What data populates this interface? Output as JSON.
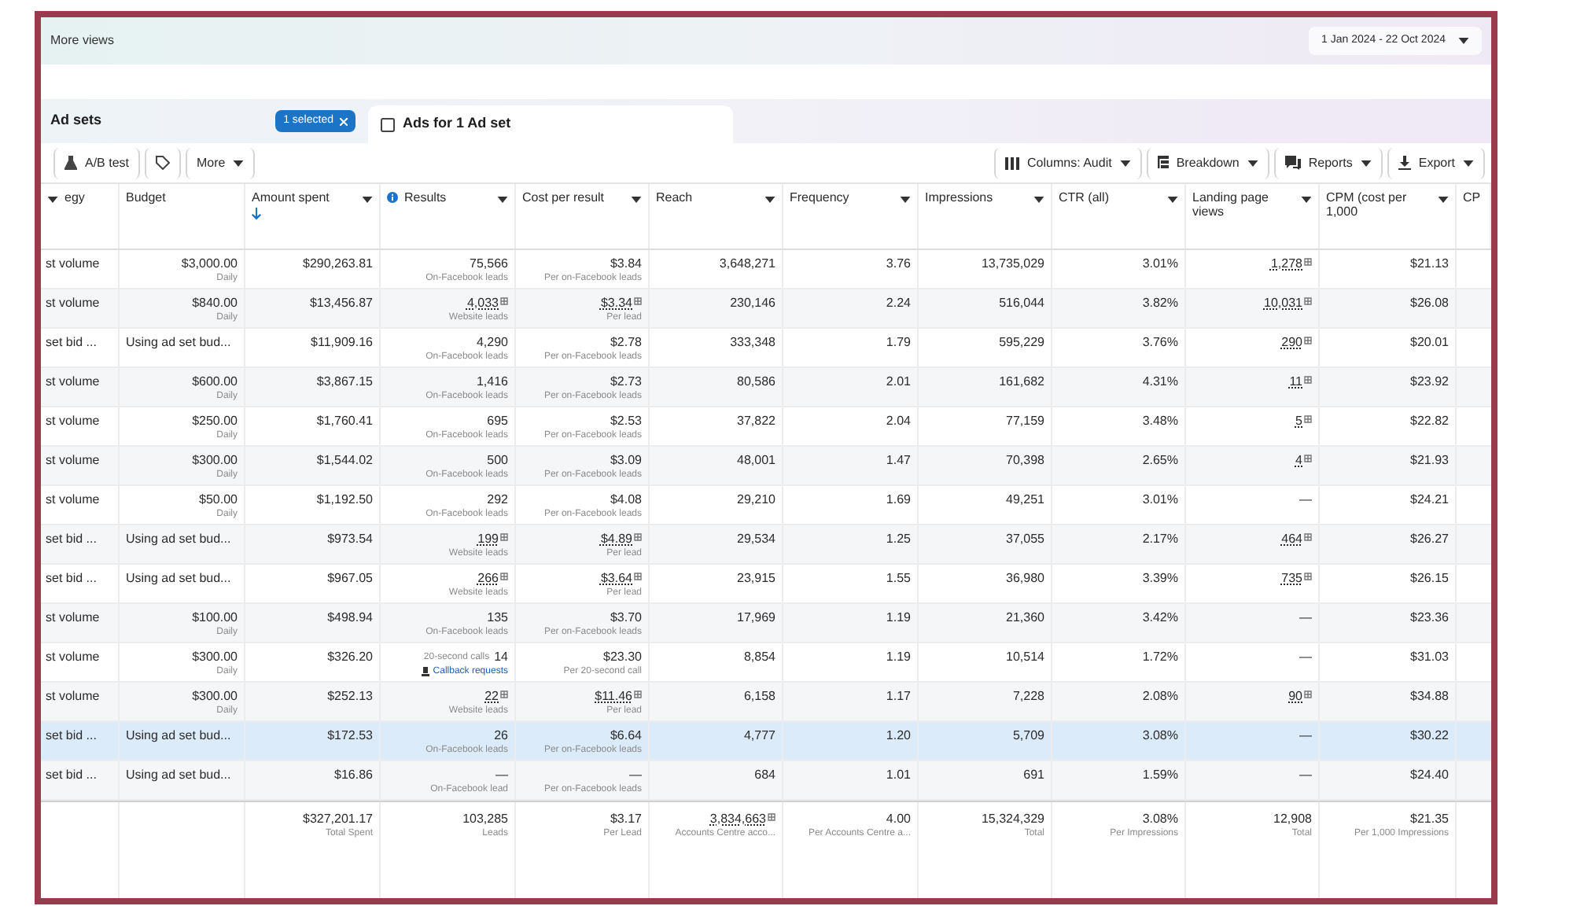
{
  "top_bar": {
    "title": "More views",
    "date_range": "1 Jan 2024 - 22 Oct 2024"
  },
  "tabs": [
    {
      "label": "Ad sets",
      "selected": false,
      "badge": "1 selected"
    },
    {
      "label": "Ads for 1 Ad set",
      "selected": true
    }
  ],
  "toolbar": {
    "left": [
      {
        "kind": "flask",
        "label": "A/B test",
        "caret": false
      },
      {
        "kind": "tag",
        "caret": false
      },
      {
        "kind": "none",
        "label": "More",
        "caret": true
      }
    ],
    "right": [
      {
        "kind": "columns",
        "label": "Columns: Audit",
        "caret": true
      },
      {
        "kind": "breakdown",
        "label": "Breakdown",
        "caret": true
      },
      {
        "kind": "reports",
        "label": "Reports",
        "caret": true
      },
      {
        "kind": "export",
        "label": "Export",
        "caret": true
      }
    ]
  },
  "table": {
    "leading_caret": true,
    "columns": [
      {
        "label": "egy",
        "caret": false,
        "sorted": false,
        "info": false
      },
      {
        "label": "Budget",
        "caret": false,
        "sorted": false,
        "info": false
      },
      {
        "label": "Amount spent",
        "caret": true,
        "sorted": true,
        "info": false
      },
      {
        "label": "Results",
        "caret": true,
        "sorted": false,
        "info": true
      },
      {
        "label": "Cost per result",
        "caret": true,
        "sorted": false,
        "info": false
      },
      {
        "label": "Reach",
        "caret": true,
        "sorted": false,
        "info": false
      },
      {
        "label": "Frequency",
        "caret": true,
        "sorted": false,
        "info": false
      },
      {
        "label": "Impressions",
        "caret": true,
        "sorted": false,
        "info": false
      },
      {
        "label": "CTR (all)",
        "caret": true,
        "sorted": false,
        "info": false
      },
      {
        "label": "Landing page views",
        "caret": true,
        "sorted": false,
        "info": false
      },
      {
        "label": "CPM (cost per 1,000",
        "caret": true,
        "sorted": false,
        "info": false
      },
      {
        "label": "CP",
        "caret": false,
        "sorted": false,
        "info": false
      }
    ],
    "rows": [
      {
        "selected": false,
        "strategy": "st volume",
        "budget": "$3,000.00",
        "budget_period": "Daily",
        "amount_spent": "$290,263.81",
        "results": "75,566",
        "results_label": "On-Facebook leads",
        "results_linked": false,
        "cost": "$3.84",
        "cost_label": "Per on-Facebook leads",
        "cost_linked": false,
        "reach": "3,648,271",
        "frequency": "3.76",
        "impressions": "13,735,029",
        "ctr": "3.01%",
        "landing_views": "1,278",
        "landing_linked": true,
        "cpm": "$21.13"
      },
      {
        "selected": false,
        "strategy": "st volume",
        "budget": "$840.00",
        "budget_period": "Daily",
        "amount_spent": "$13,456.87",
        "results": "4,033",
        "results_label": "Website leads",
        "results_linked": true,
        "cost": "$3.34",
        "cost_label": "Per lead",
        "cost_linked": true,
        "reach": "230,146",
        "frequency": "2.24",
        "impressions": "516,044",
        "ctr": "3.82%",
        "landing_views": "10,031",
        "landing_linked": true,
        "cpm": "$26.08"
      },
      {
        "selected": false,
        "strategy": "set bid ...",
        "budget": "Using ad set bud...",
        "amount_spent": "$11,909.16",
        "results": "4,290",
        "results_label": "On-Facebook leads",
        "results_linked": false,
        "cost": "$2.78",
        "cost_label": "Per on-Facebook leads",
        "cost_linked": false,
        "reach": "333,348",
        "frequency": "1.79",
        "impressions": "595,229",
        "ctr": "3.76%",
        "landing_views": "290",
        "landing_linked": true,
        "cpm": "$20.01"
      },
      {
        "selected": false,
        "strategy": "st volume",
        "budget": "$600.00",
        "budget_period": "Daily",
        "amount_spent": "$3,867.15",
        "results": "1,416",
        "results_label": "On-Facebook leads",
        "results_linked": false,
        "cost": "$2.73",
        "cost_label": "Per on-Facebook leads",
        "cost_linked": false,
        "reach": "80,586",
        "frequency": "2.01",
        "impressions": "161,682",
        "ctr": "4.31%",
        "landing_views": "11",
        "landing_linked": true,
        "cpm": "$23.92"
      },
      {
        "selected": false,
        "strategy": "st volume",
        "budget": "$250.00",
        "budget_period": "Daily",
        "amount_spent": "$1,760.41",
        "results": "695",
        "results_label": "On-Facebook leads",
        "results_linked": false,
        "cost": "$2.53",
        "cost_label": "Per on-Facebook leads",
        "cost_linked": false,
        "reach": "37,822",
        "frequency": "2.04",
        "impressions": "77,159",
        "ctr": "3.48%",
        "landing_views": "5",
        "landing_linked": true,
        "cpm": "$22.82"
      },
      {
        "selected": false,
        "strategy": "st volume",
        "budget": "$300.00",
        "budget_period": "Daily",
        "amount_spent": "$1,544.02",
        "results": "500",
        "results_label": "On-Facebook leads",
        "results_linked": false,
        "cost": "$3.09",
        "cost_label": "Per on-Facebook leads",
        "cost_linked": false,
        "reach": "48,001",
        "frequency": "1.47",
        "impressions": "70,398",
        "ctr": "2.65%",
        "landing_views": "4",
        "landing_linked": true,
        "cpm": "$21.93"
      },
      {
        "selected": false,
        "strategy": "st volume",
        "budget": "$50.00",
        "budget_period": "Daily",
        "amount_spent": "$1,192.50",
        "results": "292",
        "results_label": "On-Facebook leads",
        "results_linked": false,
        "cost": "$4.08",
        "cost_label": "Per on-Facebook leads",
        "cost_linked": false,
        "reach": "29,210",
        "frequency": "1.69",
        "impressions": "49,251",
        "ctr": "3.01%",
        "landing_views": "—",
        "landing_linked": false,
        "cpm": "$24.21"
      },
      {
        "selected": false,
        "strategy": "set bid ...",
        "budget": "Using ad set bud...",
        "amount_spent": "$973.54",
        "results": "199",
        "results_label": "Website leads",
        "results_linked": true,
        "cost": "$4.89",
        "cost_label": "Per lead",
        "cost_linked": true,
        "reach": "29,534",
        "frequency": "1.25",
        "impressions": "37,055",
        "ctr": "2.17%",
        "landing_views": "464",
        "landing_linked": true,
        "cpm": "$26.27"
      },
      {
        "selected": false,
        "strategy": "set bid ...",
        "budget": "Using ad set bud...",
        "amount_spent": "$967.05",
        "results": "266",
        "results_label": "Website leads",
        "results_linked": true,
        "cost": "$3.64",
        "cost_label": "Per lead",
        "cost_linked": true,
        "reach": "23,915",
        "frequency": "1.55",
        "impressions": "36,980",
        "ctr": "3.39%",
        "landing_views": "735",
        "landing_linked": true,
        "cpm": "$26.15"
      },
      {
        "selected": false,
        "strategy": "st volume",
        "budget": "$100.00",
        "budget_period": "Daily",
        "amount_spent": "$498.94",
        "results": "135",
        "results_label": "On-Facebook leads",
        "results_linked": false,
        "cost": "$3.70",
        "cost_label": "Per on-Facebook leads",
        "cost_linked": false,
        "reach": "17,969",
        "frequency": "1.19",
        "impressions": "21,360",
        "ctr": "3.42%",
        "landing_views": "—",
        "landing_linked": false,
        "cpm": "$23.36"
      },
      {
        "selected": false,
        "strategy": "st volume",
        "budget": "$300.00",
        "budget_period": "Daily",
        "amount_spent": "$326.20",
        "results_note": "20-second calls",
        "results": "14",
        "results_action": "Callback requests",
        "results_linked": false,
        "cost": "$23.30",
        "cost_label": "Per 20-second call",
        "cost_linked": false,
        "reach": "8,854",
        "frequency": "1.19",
        "impressions": "10,514",
        "ctr": "1.72%",
        "landing_views": "—",
        "landing_linked": false,
        "cpm": "$31.03"
      },
      {
        "selected": false,
        "strategy": "st volume",
        "budget": "$300.00",
        "budget_period": "Daily",
        "amount_spent": "$252.13",
        "results": "22",
        "results_label": "Website leads",
        "results_linked": true,
        "cost": "$11.46",
        "cost_label": "Per lead",
        "cost_linked": true,
        "reach": "6,158",
        "frequency": "1.17",
        "impressions": "7,228",
        "ctr": "2.08%",
        "landing_views": "90",
        "landing_linked": true,
        "cpm": "$34.88"
      },
      {
        "selected": true,
        "strategy": "set bid ...",
        "budget": "Using ad set bud...",
        "amount_spent": "$172.53",
        "results": "26",
        "results_label": "On-Facebook leads",
        "results_linked": false,
        "cost": "$6.64",
        "cost_label": "Per on-Facebook leads",
        "cost_linked": false,
        "reach": "4,777",
        "frequency": "1.20",
        "impressions": "5,709",
        "ctr": "3.08%",
        "landing_views": "—",
        "landing_linked": false,
        "cpm": "$30.22"
      },
      {
        "selected": false,
        "strategy": "set bid ...",
        "budget": "Using ad set bud...",
        "amount_spent": "$16.86",
        "results": "—",
        "results_label": "On-Facebook lead",
        "results_linked": false,
        "cost": "—",
        "cost_label": "Per on-Facebook leads",
        "cost_linked": false,
        "reach": "684",
        "frequency": "1.01",
        "impressions": "691",
        "ctr": "1.59%",
        "landing_views": "—",
        "landing_linked": false,
        "cpm": "$24.40"
      }
    ],
    "totals": [
      {
        "value": "$327,201.17",
        "caption": "Total Spent",
        "linked": false
      },
      {
        "value": "103,285",
        "caption": "Leads",
        "linked": false
      },
      {
        "value": "$3.17",
        "caption": "Per Lead",
        "linked": false
      },
      {
        "value": "3,834,663",
        "caption": "Accounts Centre acco...",
        "linked": true
      },
      {
        "value": "4.00",
        "caption": "Per Accounts Centre a...",
        "linked": false
      },
      {
        "value": "15,324,329",
        "caption": "Total",
        "linked": false
      },
      {
        "value": "3.08%",
        "caption": "Per Impressions",
        "linked": false
      },
      {
        "value": "12,908",
        "caption": "Total",
        "linked": false
      },
      {
        "value": "$21.35",
        "caption": "Per 1,000 Impressions",
        "linked": false
      }
    ]
  }
}
